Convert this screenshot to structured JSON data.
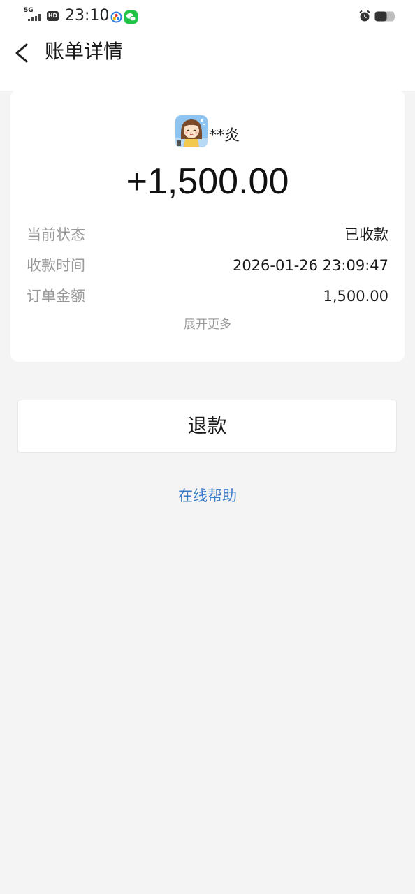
{
  "status_bar": {
    "network": "5G",
    "hd": "HD",
    "time": "23:10"
  },
  "header": {
    "title": "账单详情"
  },
  "payer": {
    "name": "**炎"
  },
  "amount": "+1,500.00",
  "details": [
    {
      "label": "当前状态",
      "value": "已收款"
    },
    {
      "label": "收款时间",
      "value": "2026-01-26 23:09:47"
    },
    {
      "label": "订单金额",
      "value": "1,500.00"
    }
  ],
  "expand_label": "展开更多",
  "refund_label": "退款",
  "help_label": "在线帮助",
  "colors": {
    "page_background": "#f4f4f4",
    "card_background": "#ffffff",
    "link": "#3a7bc8",
    "label_gray": "#9a9a9a",
    "wechat_green": "#1ec445"
  },
  "icons": {
    "back": "chevron-left-icon",
    "alarm": "alarm-clock-icon",
    "battery": "battery-icon",
    "signal": "signal-icon",
    "wechat": "wechat-icon"
  }
}
